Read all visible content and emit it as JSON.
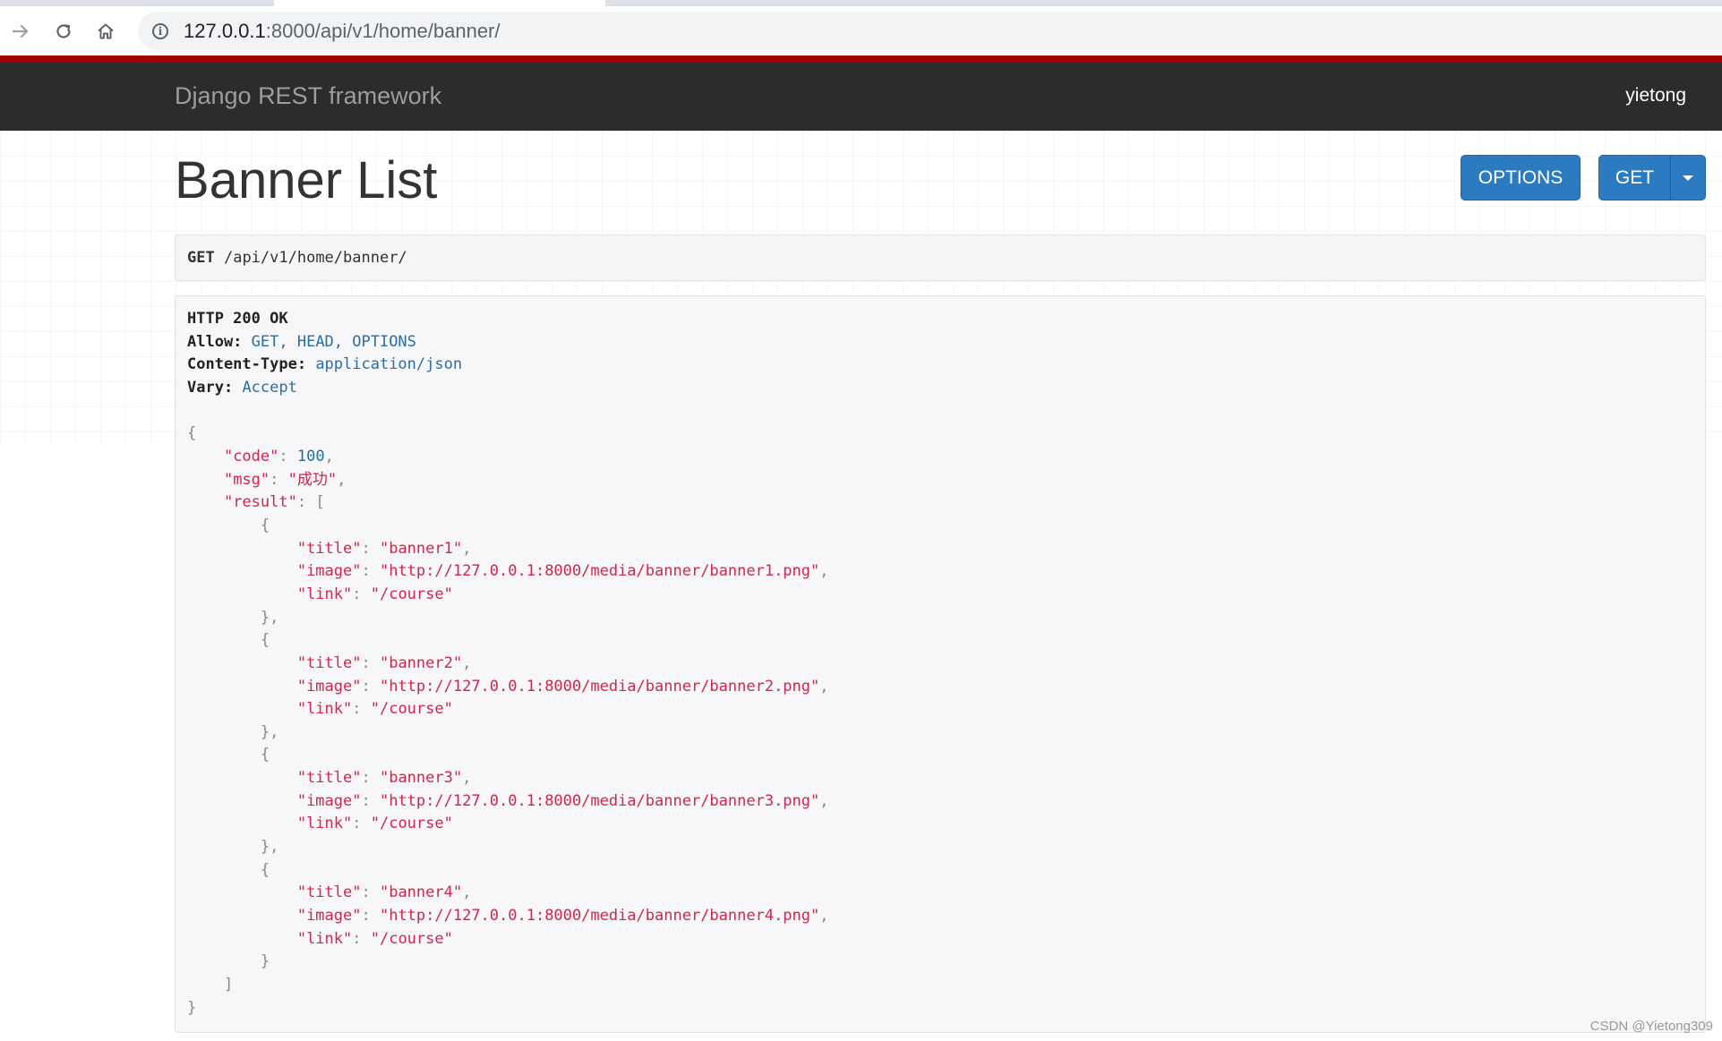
{
  "browser": {
    "url_host": "127.0.0.1",
    "url_rest": ":8000/api/v1/home/banner/"
  },
  "navbar": {
    "brand": "Django REST framework",
    "user": "yietong"
  },
  "page": {
    "title": "Banner List",
    "options_label": "OPTIONS",
    "get_label": "GET"
  },
  "request": {
    "method": "GET",
    "path": "/api/v1/home/banner/"
  },
  "response": {
    "status": "HTTP 200 OK",
    "headers": [
      {
        "key": "Allow:",
        "value": "GET, HEAD, OPTIONS"
      },
      {
        "key": "Content-Type:",
        "value": "application/json"
      },
      {
        "key": "Vary:",
        "value": "Accept"
      }
    ],
    "body": {
      "code": 100,
      "msg": "成功",
      "result": [
        {
          "title": "banner1",
          "image": "http://127.0.0.1:8000/media/banner/banner1.png",
          "link": "/course"
        },
        {
          "title": "banner2",
          "image": "http://127.0.0.1:8000/media/banner/banner2.png",
          "link": "/course"
        },
        {
          "title": "banner3",
          "image": "http://127.0.0.1:8000/media/banner/banner3.png",
          "link": "/course"
        },
        {
          "title": "banner4",
          "image": "http://127.0.0.1:8000/media/banner/banner4.png",
          "link": "/course"
        }
      ]
    }
  },
  "icons": {
    "forward": "arrow-right-icon",
    "reload": "reload-icon",
    "home": "home-icon",
    "info": "info-icon",
    "caret": "caret-down-icon"
  },
  "colors": {
    "navbar_bg": "#2c2c2c",
    "accent_strip": "#a30000",
    "button_bg": "#2c7bc0",
    "json_key": "#d0264b",
    "json_number": "#1f6fa3",
    "header_value": "#2a6ea9"
  },
  "watermark": "CSDN @Yietong309"
}
